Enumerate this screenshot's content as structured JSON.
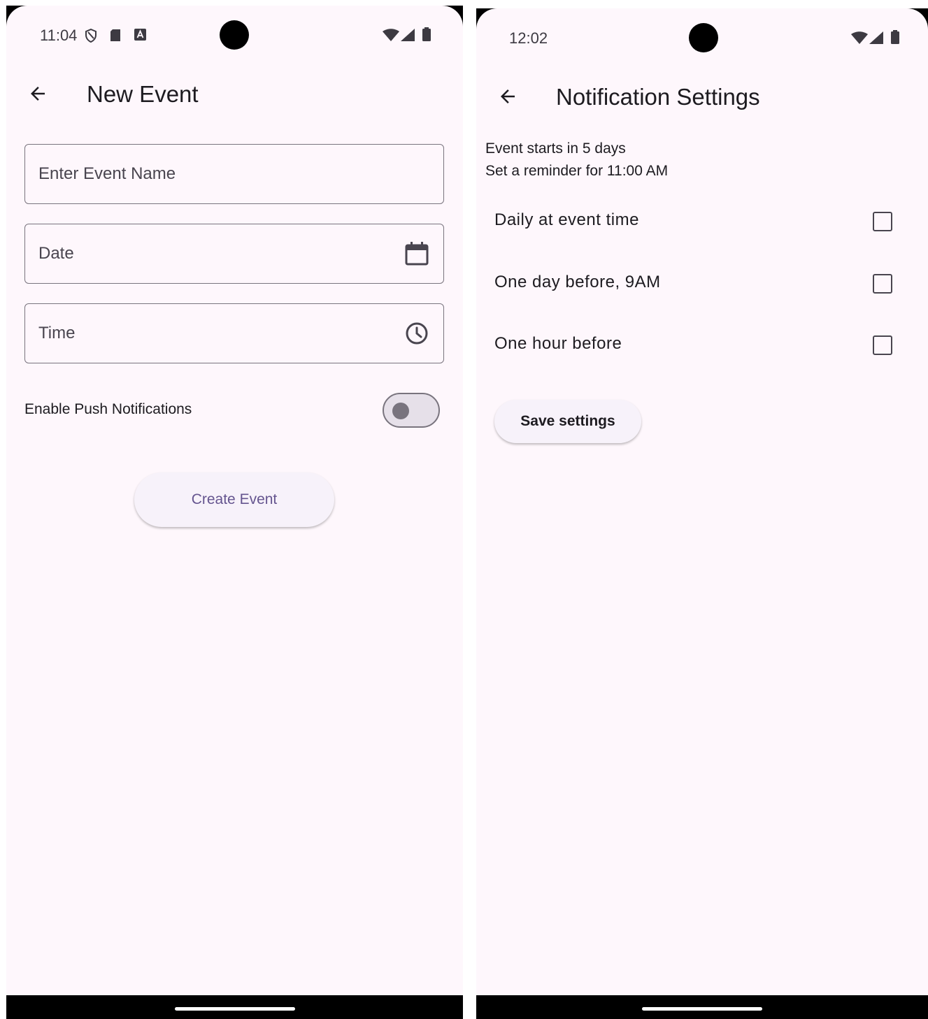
{
  "left_screen": {
    "status_bar": {
      "time": "11:04",
      "left_icons": [
        "shield-icon",
        "sd-card-icon",
        "autofill-a-icon"
      ],
      "right_icons": [
        "wifi-icon",
        "cell-signal-icon",
        "battery-icon"
      ]
    },
    "header": {
      "title": "New Event",
      "back_icon": "arrow-back-icon"
    },
    "fields": {
      "event_name": {
        "placeholder": "Enter Event Name"
      },
      "date": {
        "label": "Date",
        "icon": "calendar-icon"
      },
      "time": {
        "label": "Time",
        "icon": "clock-icon"
      }
    },
    "push_notifications": {
      "label": "Enable Push Notifications",
      "enabled": false
    },
    "create_button": {
      "label": "Create Event"
    },
    "colors": {
      "accent": "#65558f",
      "background": "#fef7fc"
    }
  },
  "right_screen": {
    "status_bar": {
      "time": "12:02",
      "right_icons": [
        "wifi-icon",
        "cell-signal-icon",
        "battery-icon"
      ]
    },
    "header": {
      "title": "Notification Settings",
      "back_icon": "arrow-back-icon"
    },
    "info": {
      "line1": "Event starts in 5 days",
      "line2": "Set a reminder for 11:00 AM"
    },
    "options": [
      {
        "label": "Daily at event time",
        "checked": false
      },
      {
        "label": "One day before, 9AM",
        "checked": false
      },
      {
        "label": "One hour before",
        "checked": false
      }
    ],
    "save_button": {
      "label": "Save settings"
    }
  }
}
